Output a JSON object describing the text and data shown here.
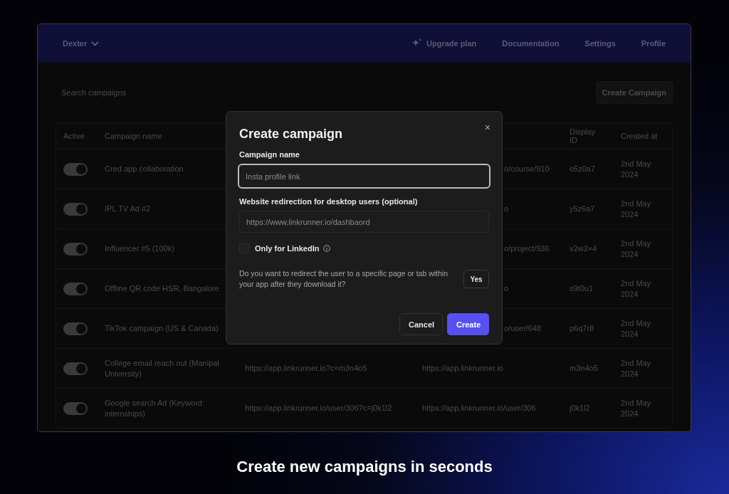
{
  "header": {
    "workspace": "Dexter",
    "nav": [
      {
        "label": "Upgrade plan",
        "kind": "upgrade"
      },
      {
        "label": "Documentation",
        "kind": "link"
      },
      {
        "label": "Settings",
        "kind": "link"
      },
      {
        "label": "Profile",
        "kind": "link"
      }
    ]
  },
  "search": {
    "placeholder": "Search campaigns"
  },
  "create_button": "Create Campaign",
  "table": {
    "columns": [
      "Active",
      "Campaign name",
      "Display ID",
      "Created at"
    ],
    "rows": [
      {
        "on": true,
        "name": "Cred app collaboration",
        "redirect": "o/course/910",
        "redirect_covered": true,
        "display_id": "o5z0a7",
        "created": "2nd May 2024"
      },
      {
        "on": true,
        "name": "IPL TV Ad #2",
        "redirect": "o",
        "redirect_covered": true,
        "display_id": "y5z6a7",
        "created": "2nd May 2024"
      },
      {
        "on": true,
        "name": "Influencer #5 (100k)",
        "redirect": "o/project/936",
        "redirect_covered": true,
        "display_id": "v2w3×4",
        "created": "2nd May 2024"
      },
      {
        "on": true,
        "name": "Offline QR code HSR, Bangalore",
        "redirect": "o",
        "redirect_covered": true,
        "display_id": "s9t0u1",
        "created": "2nd May 2024"
      },
      {
        "on": true,
        "name": "TikTok campaign (US & Canada)",
        "redirect": "o/user/648",
        "redirect_covered": true,
        "display_id": "p6q7r8",
        "created": "2nd May 2024"
      },
      {
        "on": true,
        "name": "College email reach out (Manipal University)",
        "link": "https://app.linkrunner.io?c=m3n4o5",
        "redirect": "https://app.linkrunner.io",
        "redirect_covered": false,
        "display_id": "m3n4o5",
        "created": "2nd May 2024"
      },
      {
        "on": true,
        "name": "Google search Ad (Keyword: internships)",
        "link": "https://app.linkrunner.io/user/306?c=j0k1l2",
        "redirect": "https://app.linkrunner.io/user/306",
        "redirect_covered": false,
        "display_id": "j0k1l2",
        "created": "2nd May 2024"
      }
    ]
  },
  "dialog": {
    "title": "Create campaign",
    "close": "×",
    "fields": [
      {
        "label": "Campaign name",
        "placeholder": "Insta profile link",
        "focused": true
      },
      {
        "label": "Website redirection for desktop users (optional)",
        "placeholder": "https://www.linkrunner.io/dashbaord",
        "focused": false
      }
    ],
    "checkbox": {
      "label": "Only for LinkedIn",
      "checked": false
    },
    "question": "Do you want to redirect the user to a specific page or tab within your app after they download it?",
    "question_button": "Yes",
    "buttons": [
      {
        "label": "Cancel",
        "kind": "secondary"
      },
      {
        "label": "Create",
        "kind": "primary"
      }
    ]
  },
  "caption": "Create new campaigns in seconds"
}
